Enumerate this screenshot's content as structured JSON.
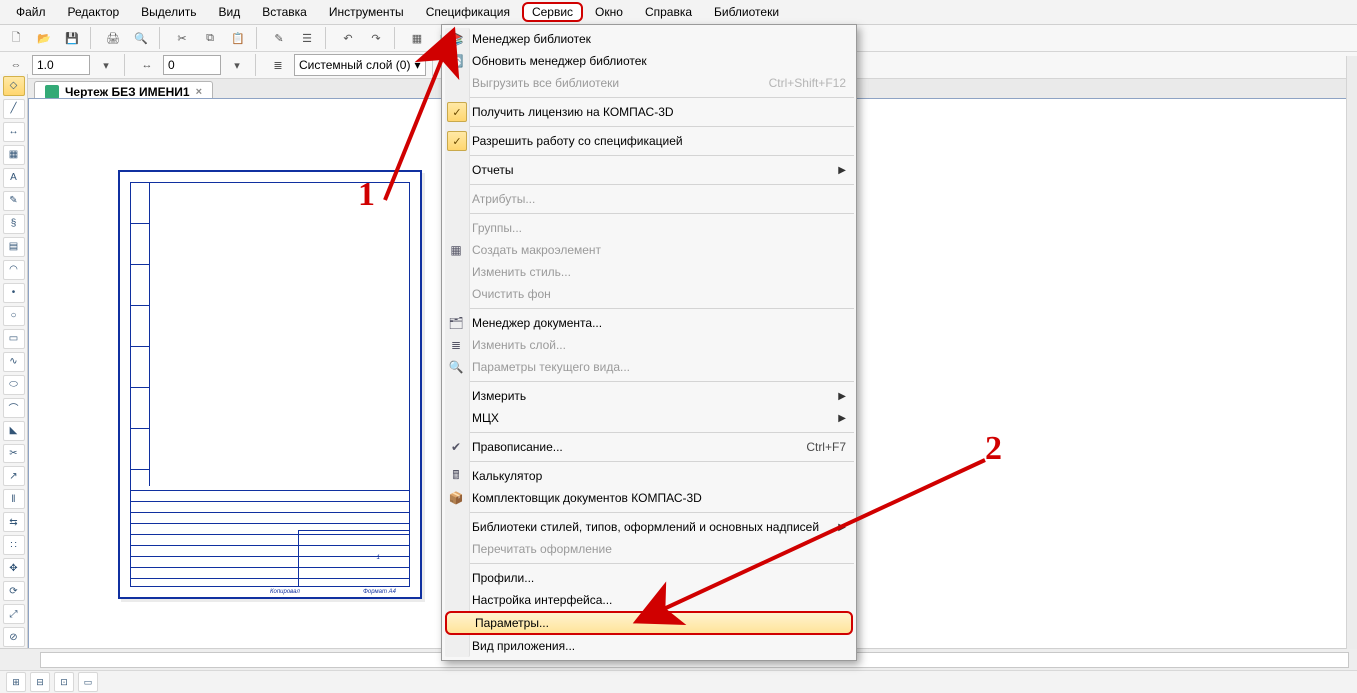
{
  "menubar": {
    "file": "Файл",
    "editor": "Редактор",
    "select": "Выделить",
    "view": "Вид",
    "insert": "Вставка",
    "tools": "Инструменты",
    "spec": "Спецификация",
    "service": "Сервис",
    "window": "Окно",
    "help": "Справка",
    "libs": "Библиотеки"
  },
  "toolbar2": {
    "scale": "1.0",
    "step": "0",
    "layer": "Системный слой (0)"
  },
  "tab": {
    "title": "Чертеж БЕЗ ИМЕНИ1"
  },
  "annotations": {
    "n1": "1",
    "n2": "2"
  },
  "sheet": {
    "footer_left": "Копировал",
    "footer_right": "Формат   A4",
    "page": "1"
  },
  "ctx": {
    "lib_mgr": "Менеджер библиотек",
    "lib_upd": "Обновить менеджер библиотек",
    "lib_unload": "Выгрузить все библиотеки",
    "lib_unload_sc": "Ctrl+Shift+F12",
    "license": "Получить лицензию на КОМПАС-3D",
    "spec_allow": "Разрешить работу со спецификацией",
    "reports": "Отчеты",
    "attrs": "Атрибуты...",
    "groups": "Группы...",
    "macro": "Создать макроэлемент",
    "chstyle": "Изменить стиль...",
    "clearbg": "Очистить фон",
    "doc_mgr": "Менеджер документа...",
    "chlayer": "Изменить слой...",
    "curview": "Параметры текущего вида...",
    "measure": "Измерить",
    "mcx": "МЦХ",
    "spelling": "Правописание...",
    "spelling_sc": "Ctrl+F7",
    "calc": "Калькулятор",
    "komplekt": "Комплектовщик документов КОМПАС-3D",
    "stylelib": "Библиотеки стилей, типов, оформлений и основных надписей",
    "reread": "Перечитать оформление",
    "profiles": "Профили...",
    "uiset": "Настройка интерфейса...",
    "params": "Параметры...",
    "appview": "Вид приложения..."
  }
}
